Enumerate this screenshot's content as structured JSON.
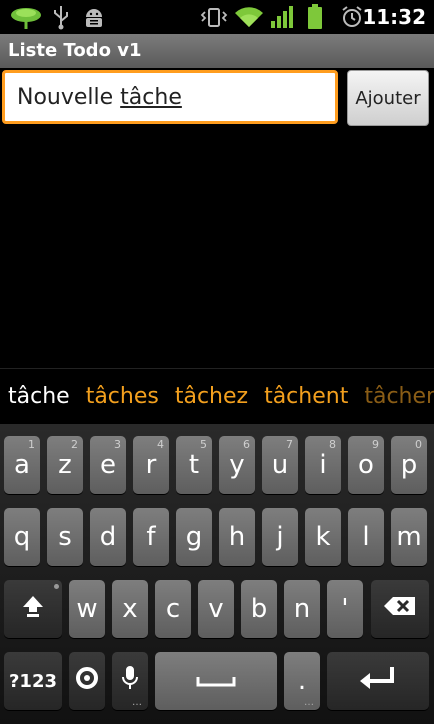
{
  "status_bar": {
    "time": "11:32",
    "icons": [
      "app-leaf-icon",
      "usb-icon",
      "android-debug-icon",
      "vibrate-icon",
      "wifi-icon",
      "signal-icon",
      "battery-icon",
      "alarm-icon"
    ]
  },
  "title_bar": {
    "title": "Liste Todo v1"
  },
  "input": {
    "text_plain": "Nouvelle ",
    "text_underlined": "tâche"
  },
  "add_button": {
    "label": "Ajouter"
  },
  "suggestions": [
    "tâche",
    "tâches",
    "tâchez",
    "tâchent",
    "tâcher"
  ],
  "keyboard": {
    "row1": [
      {
        "label": "a",
        "hint": "1"
      },
      {
        "label": "z",
        "hint": "2"
      },
      {
        "label": "e",
        "hint": "3"
      },
      {
        "label": "r",
        "hint": "4"
      },
      {
        "label": "t",
        "hint": "5"
      },
      {
        "label": "y",
        "hint": "6"
      },
      {
        "label": "u",
        "hint": "7"
      },
      {
        "label": "i",
        "hint": "8"
      },
      {
        "label": "o",
        "hint": "9"
      },
      {
        "label": "p",
        "hint": "0"
      }
    ],
    "row2": [
      {
        "label": "q"
      },
      {
        "label": "s"
      },
      {
        "label": "d"
      },
      {
        "label": "f"
      },
      {
        "label": "g"
      },
      {
        "label": "h"
      },
      {
        "label": "j"
      },
      {
        "label": "k"
      },
      {
        "label": "l"
      },
      {
        "label": "m"
      }
    ],
    "row3": [
      {
        "label": "w"
      },
      {
        "label": "x"
      },
      {
        "label": "c"
      },
      {
        "label": "v"
      },
      {
        "label": "b"
      },
      {
        "label": "n"
      },
      {
        "label": "'"
      }
    ],
    "symbols_label": "?123",
    "period_label": "."
  }
}
